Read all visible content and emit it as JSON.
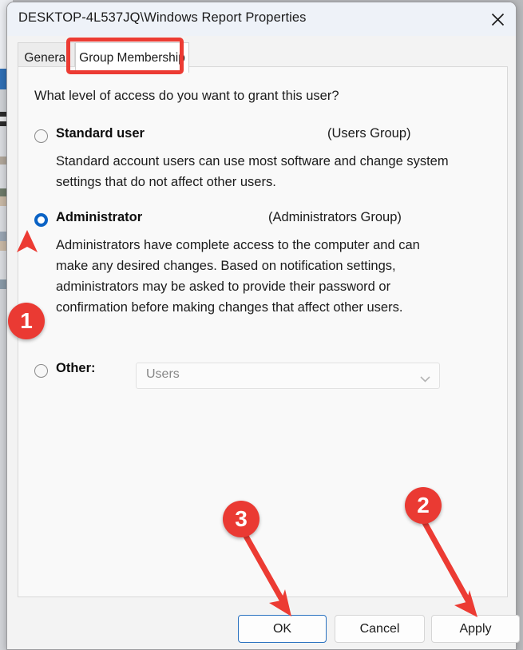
{
  "window": {
    "title": "DESKTOP-4L537JQ\\Windows Report Properties",
    "close_icon": "close-icon"
  },
  "tabs": [
    {
      "label": "General",
      "active": false
    },
    {
      "label": "Group Membership",
      "active": true
    }
  ],
  "content": {
    "prompt": "What level of access do you want to grant this user?",
    "options": [
      {
        "id": "standard",
        "label": "Standard user",
        "group": "(Users Group)",
        "selected": false,
        "description": "Standard account users can use most software and change system settings that do not affect other users."
      },
      {
        "id": "administrator",
        "label": "Administrator",
        "group": "(Administrators Group)",
        "selected": true,
        "description": "Administrators have complete access to the computer and can make any desired changes. Based on notification settings, administrators may be asked to provide their password or confirmation before making changes that affect other users."
      },
      {
        "id": "other",
        "label": "Other:",
        "selected": false,
        "combo_value": "Users",
        "combo_placeholder": "Users"
      }
    ]
  },
  "buttons": {
    "ok": "OK",
    "cancel": "Cancel",
    "apply": "Apply"
  },
  "annotations": {
    "markers": [
      {
        "number": "1",
        "target": "administrator-radio"
      },
      {
        "number": "2",
        "target": "apply-button"
      },
      {
        "number": "3",
        "target": "ok-button"
      }
    ],
    "highlight_box_target": "tab-group-membership",
    "color": "#ea3a33"
  },
  "colors": {
    "accent": "#0b63c5",
    "annotation": "#ea3a33",
    "titlebar": "#eef2f8",
    "dialog_bg": "#f3f3f3",
    "panel_bg": "#f9f9f9"
  }
}
